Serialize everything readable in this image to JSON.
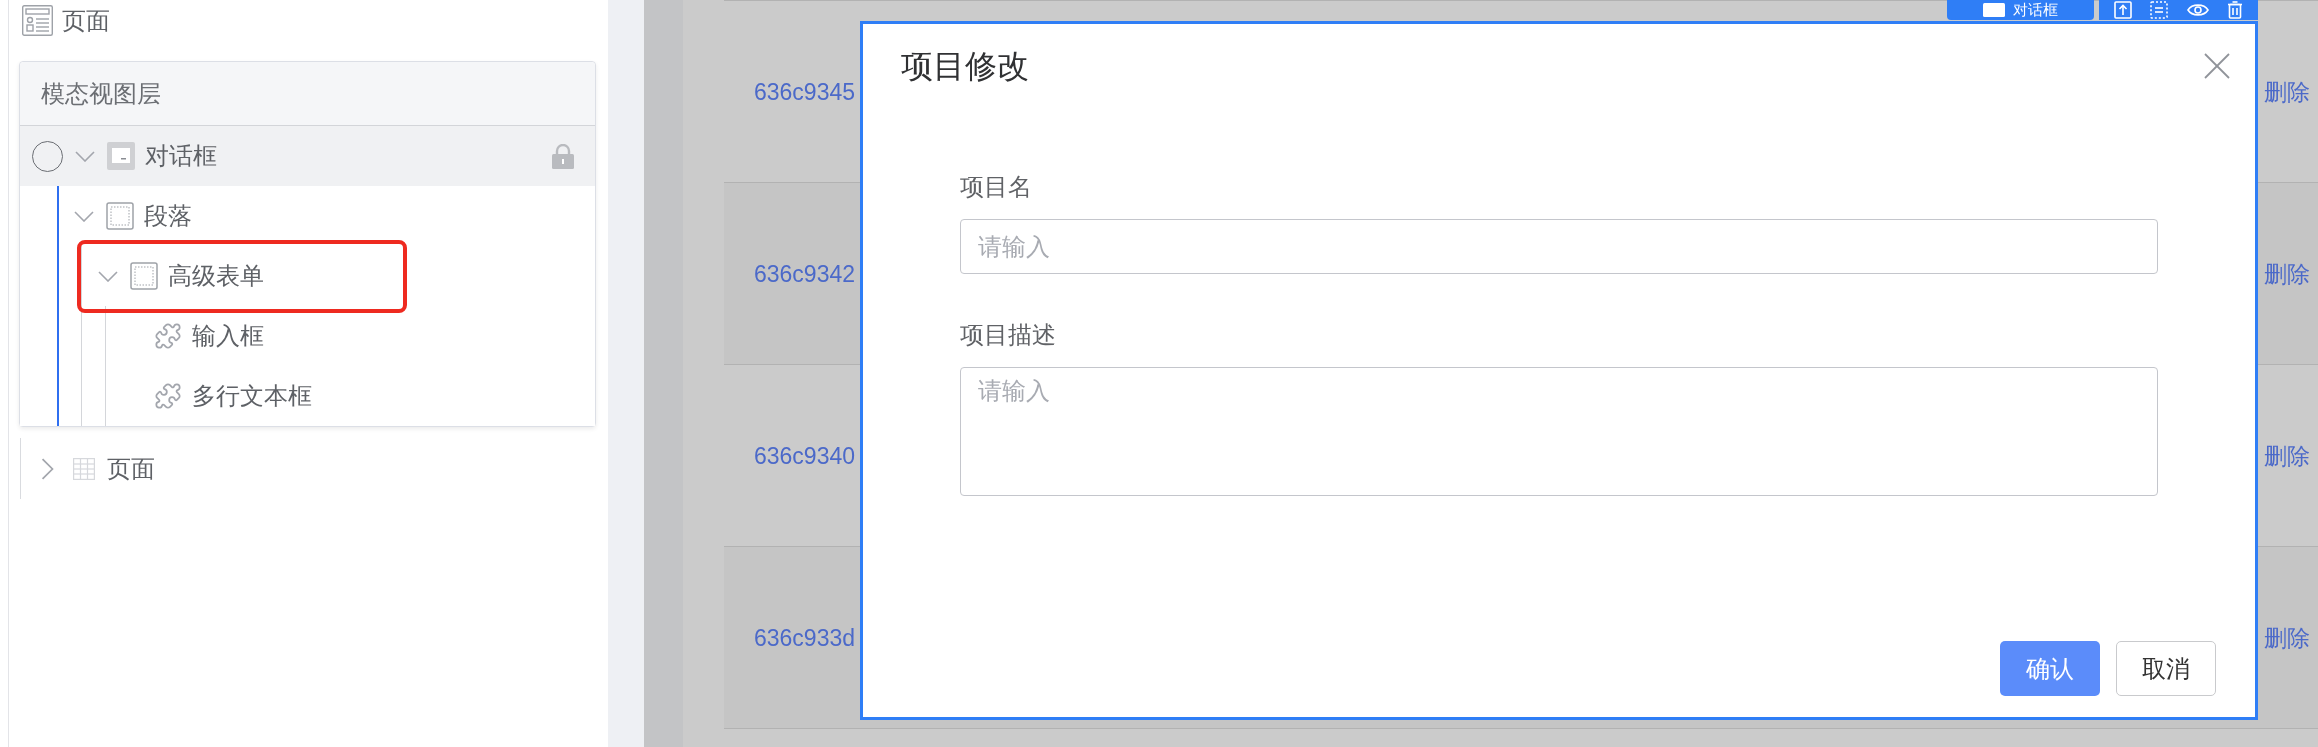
{
  "sidebar": {
    "header": {
      "label": "页面"
    },
    "layer_panel": {
      "title": "模态视图层",
      "tree": [
        {
          "label": "对话框",
          "kind": "dialog",
          "selected": true,
          "expanded": true,
          "locked": true,
          "highlighted": false,
          "children": [
            {
              "label": "段落",
              "kind": "container",
              "selected": false,
              "expanded": true,
              "locked": false,
              "highlighted": false,
              "children": [
                {
                  "label": "高级表单",
                  "kind": "container",
                  "selected": false,
                  "expanded": true,
                  "locked": false,
                  "highlighted": true,
                  "children": [
                    {
                      "label": "输入框",
                      "kind": "component",
                      "selected": false,
                      "locked": false,
                      "highlighted": false
                    },
                    {
                      "label": "多行文本框",
                      "kind": "component",
                      "selected": false,
                      "locked": false,
                      "highlighted": false
                    }
                  ]
                }
              ]
            }
          ]
        }
      ]
    },
    "page_tree": [
      {
        "label": "页面",
        "kind": "table",
        "selected": false,
        "expanded": false
      }
    ]
  },
  "canvas": {
    "selection_toolbar": {
      "label": "对话框"
    },
    "table": {
      "rows": [
        {
          "cells": [
            "636c9345",
            "删除"
          ]
        },
        {
          "cells": [
            "636c9342",
            "删除"
          ]
        },
        {
          "cells": [
            "636c9340",
            "删除"
          ]
        },
        {
          "cells": [
            "636c933d",
            "删除"
          ]
        }
      ]
    }
  },
  "dialog": {
    "title": "项目修改",
    "fields": [
      {
        "label": "项目名",
        "kind": "input",
        "placeholder": "请输入"
      },
      {
        "label": "项目描述",
        "kind": "textarea",
        "placeholder": "请输入"
      }
    ],
    "buttons": [
      {
        "label": "确认",
        "kind": "primary"
      },
      {
        "label": "取消",
        "kind": "default"
      }
    ]
  }
}
